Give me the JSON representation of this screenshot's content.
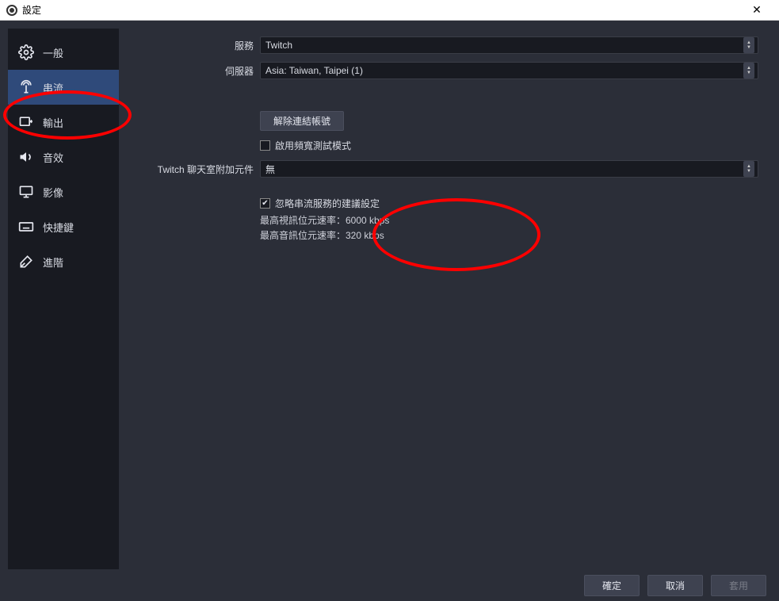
{
  "window": {
    "title": "設定",
    "close_glyph": "✕"
  },
  "sidebar": {
    "items": [
      {
        "label": "一般",
        "icon": "gear-icon"
      },
      {
        "label": "串流",
        "icon": "antenna-icon",
        "active": true
      },
      {
        "label": "輸出",
        "icon": "output-icon"
      },
      {
        "label": "音效",
        "icon": "speaker-icon"
      },
      {
        "label": "影像",
        "icon": "monitor-icon"
      },
      {
        "label": "快捷鍵",
        "icon": "keyboard-icon"
      },
      {
        "label": "進階",
        "icon": "tools-icon"
      }
    ]
  },
  "form": {
    "service_label": "服務",
    "service_value": "Twitch",
    "server_label": "伺服器",
    "server_value": "Asia: Taiwan, Taipei (1)",
    "disconnect_btn": "解除連結帳號",
    "bandwidth_test_label": "啟用頻寬測試模式",
    "bandwidth_test_checked": false,
    "chat_addon_label": "Twitch 聊天室附加元件",
    "chat_addon_value": "無",
    "ignore_recs_label": "忽略串流服務的建議設定",
    "ignore_recs_checked": true,
    "max_video_bitrate": "最高視訊位元速率：6000 kbps",
    "max_audio_bitrate": "最高音訊位元速率：320 kbps"
  },
  "footer": {
    "ok": "確定",
    "cancel": "取消",
    "apply": "套用"
  }
}
